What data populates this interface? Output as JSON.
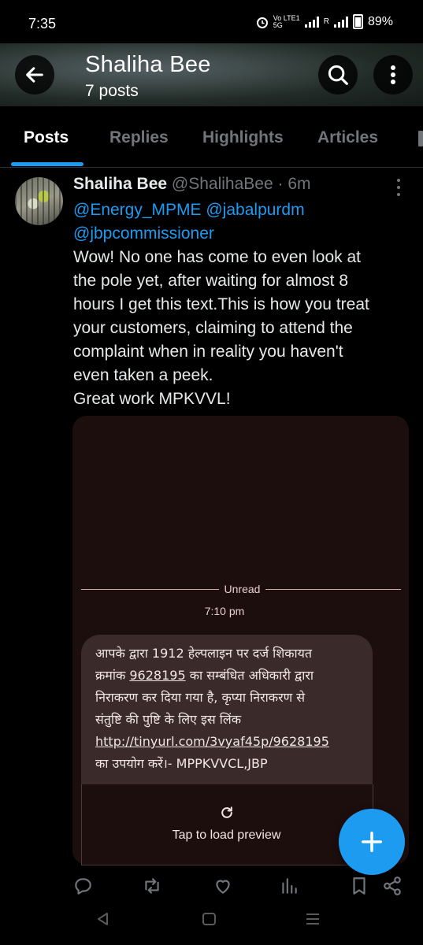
{
  "status_bar": {
    "time": "7:35",
    "network_label": "Vo LTE1 5G",
    "network_label2": "R",
    "battery": "89%"
  },
  "header": {
    "name": "Shaliha Bee",
    "post_count": "7 posts"
  },
  "tabs": [
    {
      "label": "Posts",
      "selected": true
    },
    {
      "label": "Replies",
      "selected": false
    },
    {
      "label": "Highlights",
      "selected": false
    },
    {
      "label": "Articles",
      "selected": false
    }
  ],
  "tweet": {
    "name": "Shaliha Bee",
    "handle": "@ShalihaBee",
    "separator": "·",
    "time_ago": "6m",
    "mention1": "@Energy_MPME",
    "mention2": "@jabalpurdm",
    "mention3": "@jbpcommissioner",
    "text": "Wow! No one has come to even look at\nthe pole yet, after waiting for almost 8\nhours I get this text.This is how you treat\nyour customers, claiming to attend the\ncomplaint when in reality you haven't\neven taken a peek.\nGreat work MPKVVL!",
    "media": {
      "unread_label": "Unread",
      "message_time": "7:10 pm",
      "sms_line1": "आपके द्वारा 1912 हेल्पलाइन पर दर्ज शिकायत",
      "sms_line2_prefix": "क्रमांक ",
      "sms_complaint_no": "9628195",
      "sms_line2_suffix": "  का सम्बंधित अधिकारी द्वारा",
      "sms_line3": "निराकरण कर दिया गया है, कृप्या निराकरण से",
      "sms_line4": "संतुष्टि की पुष्टि के लिए इस लिंक",
      "sms_link": "http://tinyurl.com/3vyaf45p/9628195",
      "sms_line6": "का उपयोग करें।- MPPKVVCL,JBP",
      "preview_label": "Tap to load preview"
    }
  },
  "colors": {
    "accent": "#1d9bf0",
    "background": "#000000",
    "secondary_text": "#71767b",
    "sms_bubble": "#3a2a2a"
  },
  "icons": {
    "back": "arrow-left-icon",
    "search": "search-icon",
    "more": "more-vertical-icon",
    "reply": "comment-icon",
    "repost": "repost-icon",
    "like": "heart-icon",
    "views": "bar-chart-icon",
    "bookmark": "bookmark-icon",
    "share": "share-icon",
    "compose": "plus-icon"
  }
}
